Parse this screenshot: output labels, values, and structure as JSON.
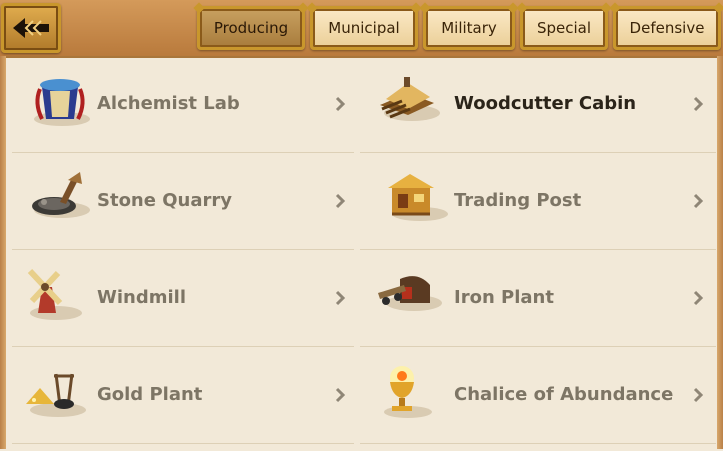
{
  "tabs": [
    {
      "label": "Producing",
      "active": true
    },
    {
      "label": "Municipal",
      "active": false
    },
    {
      "label": "Military",
      "active": false
    },
    {
      "label": "Special",
      "active": false
    },
    {
      "label": "Defensive",
      "active": false
    }
  ],
  "buildings": [
    {
      "name": "Alchemist Lab",
      "icon": "alchemist-lab-icon",
      "highlighted": false
    },
    {
      "name": "Woodcutter Cabin",
      "icon": "woodcutter-cabin-icon",
      "highlighted": true
    },
    {
      "name": "Stone Quarry",
      "icon": "stone-quarry-icon",
      "highlighted": false
    },
    {
      "name": "Trading Post",
      "icon": "trading-post-icon",
      "highlighted": false
    },
    {
      "name": "Windmill",
      "icon": "windmill-icon",
      "highlighted": false
    },
    {
      "name": "Iron Plant",
      "icon": "iron-plant-icon",
      "highlighted": false
    },
    {
      "name": "Gold Plant",
      "icon": "gold-plant-icon",
      "highlighted": false
    },
    {
      "name": "Chalice of Abundance",
      "icon": "chalice-of-abundance-icon",
      "highlighted": false
    }
  ],
  "colors": {
    "panel": "#f2e9d8",
    "frame": "#c2874a",
    "gold_border": "#c9972c",
    "label": "#7d7565",
    "label_highlight": "#2b2419"
  }
}
